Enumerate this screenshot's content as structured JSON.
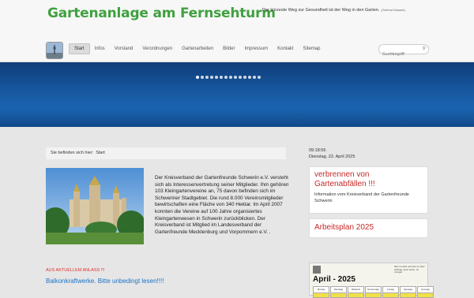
{
  "header": {
    "title": "Gartenanlage am Fernsehturm",
    "motto": "Der kürzeste Weg zur Gesundheit ist der Weg in den Garten.",
    "motto_author": "(Gertrud Mrasek)"
  },
  "nav": {
    "items": [
      "Start",
      "Infos",
      "Vorstand",
      "Verordnungen",
      "Gartenarbeiten",
      "Bilder",
      "Impressum",
      "Kontakt",
      "Sitemap"
    ],
    "active": "Start"
  },
  "search": {
    "placeholder": "Suchbegriff"
  },
  "breadcrumb": {
    "label": "Sie befinden sich hier:",
    "current": "Start"
  },
  "intro": "Der Kreisverband der Gartenfreunde Schwerin e.V. versteht sich als Interessenvertretung seiner Mitglieder. Ihm gehören 103 Kleingartenvereine an, 75 davon befinden sich im Schweriner Stadtgebiet. Die rund 8.000 Vereinsmitglieder bewirtschaften eine Fläche von 340 Hektar. Im April 2007 konnten die Vereine auf 100 Jahre organisiertes Kleingartenwesen in Schwerin zurückblicken. Der Kreisverband ist Mitglied im Landesverband der Gartenfreunde Mecklenburg und Vorpommern e.V. .",
  "news": {
    "label": "AUS AKTUELLEM ANLASS  !!!",
    "link": "Balkonkraftwerke. Bitte unbedingt lesen!!!!"
  },
  "sidebar": {
    "time": "09:18:56",
    "date": "Dienstag, 22. April 2025",
    "box1_heading": "verbrennen von Gartenabfällen !!!",
    "box1_text": "Information vom Kreisverband der Gartenfreunde Schwerin",
    "box2_heading": "Arbeitsplan 2025",
    "calendar_title": "April - 2025",
    "calendar_quote": "Wer im Gart und hier im Gart anfängt, auch wenn, ist morgen.",
    "calendar_days": [
      "Montag",
      "Dienstag",
      "Mittwoch",
      "Donnerstag",
      "Freitag",
      "Samstag",
      "Sonntag"
    ]
  },
  "slider": {
    "dots": 14,
    "active_index": 0
  },
  "colors": {
    "title_green": "#3fa13f",
    "accent_red": "#c62828",
    "link_blue": "#1a73c9",
    "banner_blue": "#16559c"
  }
}
